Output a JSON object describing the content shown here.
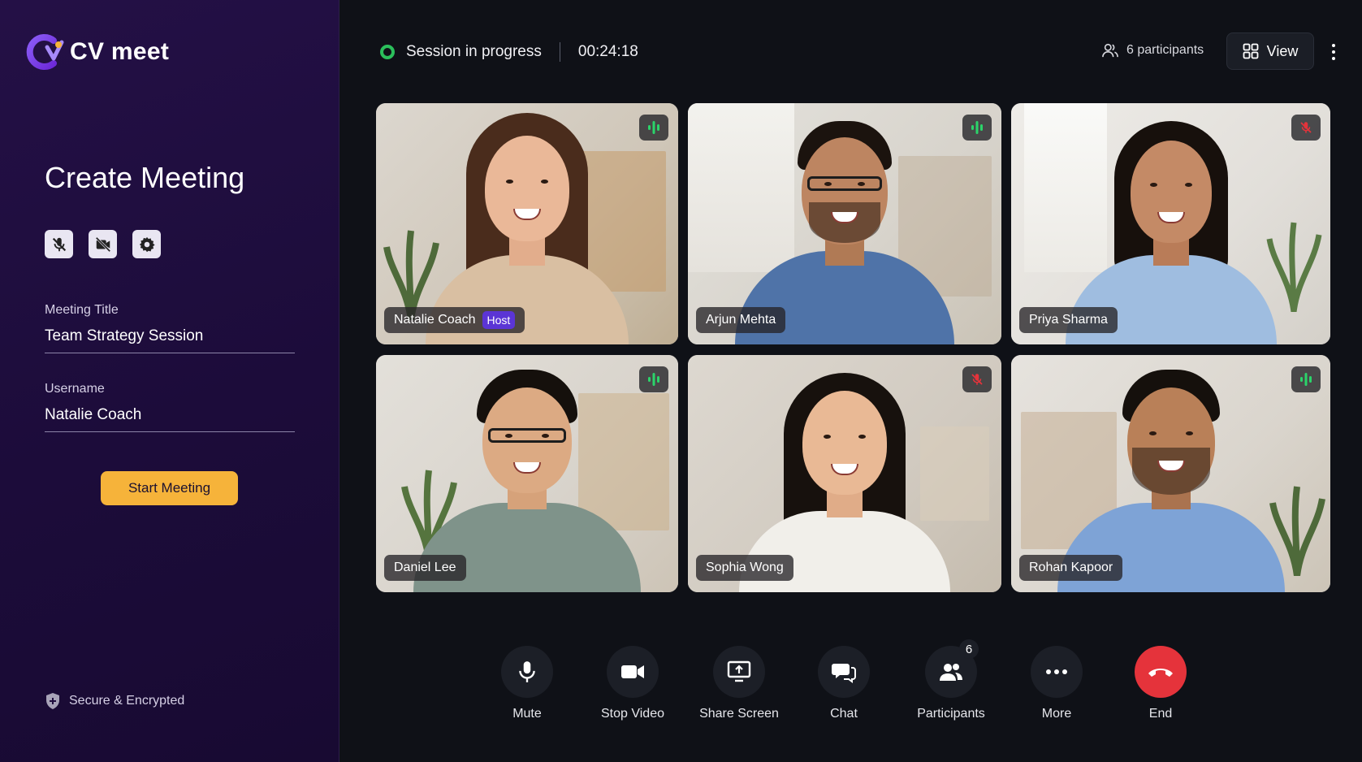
{
  "app": {
    "name": "CV meet"
  },
  "sidebar": {
    "title": "Create Meeting",
    "meeting_title_label": "Meeting Title",
    "meeting_title_value": "Team Strategy Session",
    "username_label": "Username",
    "username_value": "Natalie Coach",
    "start_button": "Start Meeting",
    "secure_text": "Secure & Encrypted",
    "toggles": [
      "mic-off-icon",
      "video-off-icon",
      "gear-icon"
    ]
  },
  "topbar": {
    "status": "Session in progress",
    "timer": "00:24:18",
    "participants": "6 participants",
    "view_label": "View"
  },
  "tiles": [
    {
      "name": "Natalie Coach",
      "badge": "Host",
      "mic": "speaking"
    },
    {
      "name": "Arjun Mehta",
      "badge": "",
      "mic": "speaking"
    },
    {
      "name": "Priya Sharma",
      "badge": "",
      "mic": "muted"
    },
    {
      "name": "Daniel Lee",
      "badge": "",
      "mic": "speaking"
    },
    {
      "name": "Sophia Wong",
      "badge": "",
      "mic": "muted"
    },
    {
      "name": "Rohan Kapoor",
      "badge": "",
      "mic": "speaking"
    }
  ],
  "controls": {
    "mute": "Mute",
    "stop_video": "Stop Video",
    "share_screen": "Share Screen",
    "chat": "Chat",
    "participants": "Participants",
    "participants_badge": "6",
    "more": "More",
    "end": "End"
  },
  "colors": {
    "sidebar_bg": "#1f0d3d",
    "main_bg": "#0f1117",
    "accent": "#f6b33a",
    "status_green": "#2bbf5b",
    "speaking_green": "#2bd46a",
    "muted_red": "#e5333b",
    "host_badge": "#5b35d5"
  }
}
